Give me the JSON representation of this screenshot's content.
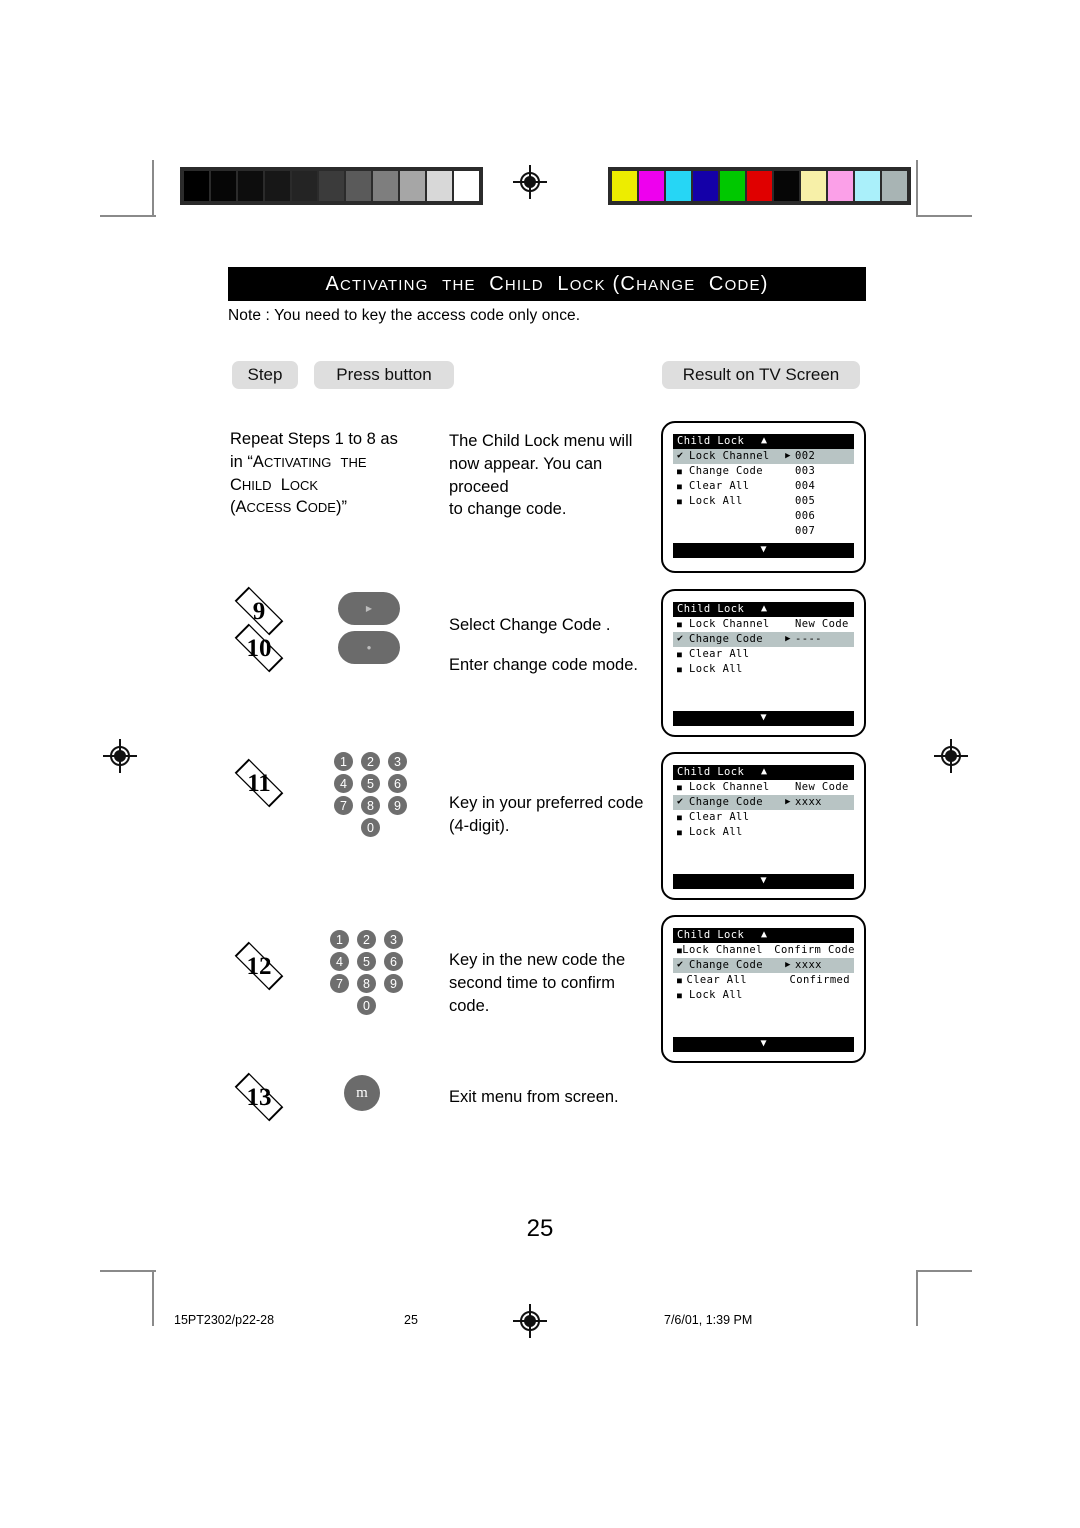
{
  "document": {
    "title_main": "A",
    "title_full": "ACTIVATING  THE  CHILD  LOCK (CHANGE  CODE)",
    "note": "Note  : You need to key the access code only once.",
    "page_number": "25"
  },
  "headers": {
    "step": "Step",
    "press_button": "Press button",
    "result": "Result on TV Screen"
  },
  "rows": [
    {
      "step_label": "",
      "instruction_lines": [
        "Repeat Steps 1 to 8 as",
        "in “ACTIVATING   THE",
        "CHILD  LOCK",
        "(ACCESS CODE)”"
      ],
      "result_lines": [
        "The Child Lock menu will",
        "now appear. You can proceed",
        "to change code."
      ]
    },
    {
      "step_label_a": "9",
      "step_label_b": "10",
      "result_lines": [
        "Select Change Code .",
        "Enter change code  mode."
      ]
    },
    {
      "step_label": "11",
      "result_lines": [
        "Key in your preferred code",
        "(4-digit)."
      ]
    },
    {
      "step_label": "12",
      "result_lines": [
        "Key in the new code the",
        "second time to confirm",
        "code."
      ]
    },
    {
      "step_label": "13",
      "key_label": "m",
      "result_lines": [
        "Exit menu from screen."
      ]
    }
  ],
  "numpad_keys": [
    "1",
    "2",
    "3",
    "4",
    "5",
    "6",
    "7",
    "8",
    "9",
    "0"
  ],
  "tv_screens": [
    {
      "header": "Child Lock",
      "up_arrow": "▲",
      "down_arrow": "▼",
      "items": [
        {
          "marker": "check",
          "label": "Lock Channel",
          "arrow": "▶",
          "value": "002",
          "highlight": true
        },
        {
          "marker": "square",
          "label": "Change Code",
          "arrow": "",
          "value": "003",
          "highlight": false
        },
        {
          "marker": "square",
          "label": "Clear All",
          "arrow": "",
          "value": "004",
          "highlight": false
        },
        {
          "marker": "square",
          "label": "Lock All",
          "arrow": "",
          "value": "005",
          "highlight": false
        }
      ],
      "extra_values": [
        "006",
        "007"
      ]
    },
    {
      "header": "Child Lock",
      "up_arrow": "▲",
      "down_arrow": "▼",
      "items": [
        {
          "marker": "square",
          "label": "Lock Channel",
          "arrow": "",
          "value": "New Code",
          "highlight": false
        },
        {
          "marker": "check",
          "label": "Change Code",
          "arrow": "▶",
          "value": "----",
          "highlight": true
        },
        {
          "marker": "square",
          "label": "Clear All",
          "arrow": "",
          "value": "",
          "highlight": false
        },
        {
          "marker": "square",
          "label": "Lock All",
          "arrow": "",
          "value": "",
          "highlight": false
        }
      ],
      "extra_values": []
    },
    {
      "header": "Child Lock",
      "up_arrow": "▲",
      "down_arrow": "▼",
      "items": [
        {
          "marker": "square",
          "label": "Lock Channel",
          "arrow": "",
          "value": "New Code",
          "highlight": false
        },
        {
          "marker": "check",
          "label": "Change Code",
          "arrow": "▶",
          "value": "xxxx",
          "highlight": true
        },
        {
          "marker": "square",
          "label": "Clear All",
          "arrow": "",
          "value": "",
          "highlight": false
        },
        {
          "marker": "square",
          "label": "Lock All",
          "arrow": "",
          "value": "",
          "highlight": false
        }
      ],
      "extra_values": []
    },
    {
      "header": "Child Lock",
      "up_arrow": "▲",
      "down_arrow": "▼",
      "items": [
        {
          "marker": "square",
          "label": "Lock Channel",
          "arrow": "",
          "value": "Confirm Code",
          "highlight": false
        },
        {
          "marker": "check",
          "label": "Change Code",
          "arrow": "▶",
          "value": "xxxx",
          "highlight": true
        },
        {
          "marker": "square",
          "label": "Clear All",
          "arrow": "",
          "value": "Confirmed",
          "highlight": false
        },
        {
          "marker": "square",
          "label": "Lock All",
          "arrow": "",
          "value": "",
          "highlight": false
        }
      ],
      "extra_values": []
    }
  ],
  "footer": {
    "left": "15PT2302/p22-28",
    "center": "25",
    "right": "7/6/01, 1:39 PM"
  },
  "calibration": {
    "grayscale": [
      "#000000",
      "#060606",
      "#0d0d0d",
      "#171717",
      "#242424",
      "#3b3b3b",
      "#5a5a5a",
      "#7e7e7e",
      "#a6a6a6",
      "#d8d8d8",
      "#ffffff"
    ],
    "colors": [
      "#eded00",
      "#ee00ee",
      "#26d6f5",
      "#1400a8",
      "#00c800",
      "#e00000",
      "#060606",
      "#f7f0a8",
      "#fba0e8",
      "#aaf0fa",
      "#a8b4b4"
    ]
  }
}
